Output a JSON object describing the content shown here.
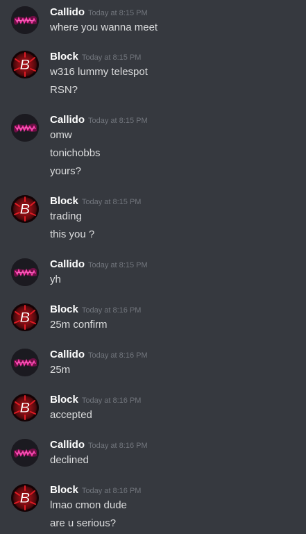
{
  "colors": {
    "background": "#36393f",
    "author": "#ffffff",
    "timestamp": "#72767d",
    "text": "#dcddde"
  },
  "messages": [
    {
      "author": "Callido",
      "avatar": "callido-avatar-icon",
      "timestamp": "Today at 8:15 PM",
      "lines": [
        "where you wanna meet"
      ]
    },
    {
      "author": "Block",
      "avatar": "block-avatar-icon",
      "timestamp": "Today at 8:15 PM",
      "lines": [
        "w316 lummy telespot",
        "RSN?"
      ]
    },
    {
      "author": "Callido",
      "avatar": "callido-avatar-icon",
      "timestamp": "Today at 8:15 PM",
      "lines": [
        "omw",
        "tonichobbs",
        "yours?"
      ]
    },
    {
      "author": "Block",
      "avatar": "block-avatar-icon",
      "timestamp": "Today at 8:15 PM",
      "lines": [
        "trading",
        "this you ?"
      ]
    },
    {
      "author": "Callido",
      "avatar": "callido-avatar-icon",
      "timestamp": "Today at 8:15 PM",
      "lines": [
        "yh"
      ]
    },
    {
      "author": "Block",
      "avatar": "block-avatar-icon",
      "timestamp": "Today at 8:16 PM",
      "lines": [
        "25m confirm"
      ]
    },
    {
      "author": "Callido",
      "avatar": "callido-avatar-icon",
      "timestamp": "Today at 8:16 PM",
      "lines": [
        "25m"
      ]
    },
    {
      "author": "Block",
      "avatar": "block-avatar-icon",
      "timestamp": "Today at 8:16 PM",
      "lines": [
        "accepted"
      ]
    },
    {
      "author": "Callido",
      "avatar": "callido-avatar-icon",
      "timestamp": "Today at 8:16 PM",
      "lines": [
        "declined"
      ]
    },
    {
      "author": "Block",
      "avatar": "block-avatar-icon",
      "timestamp": "Today at 8:16 PM",
      "lines": [
        "lmao cmon dude",
        "are u serious?"
      ]
    }
  ]
}
